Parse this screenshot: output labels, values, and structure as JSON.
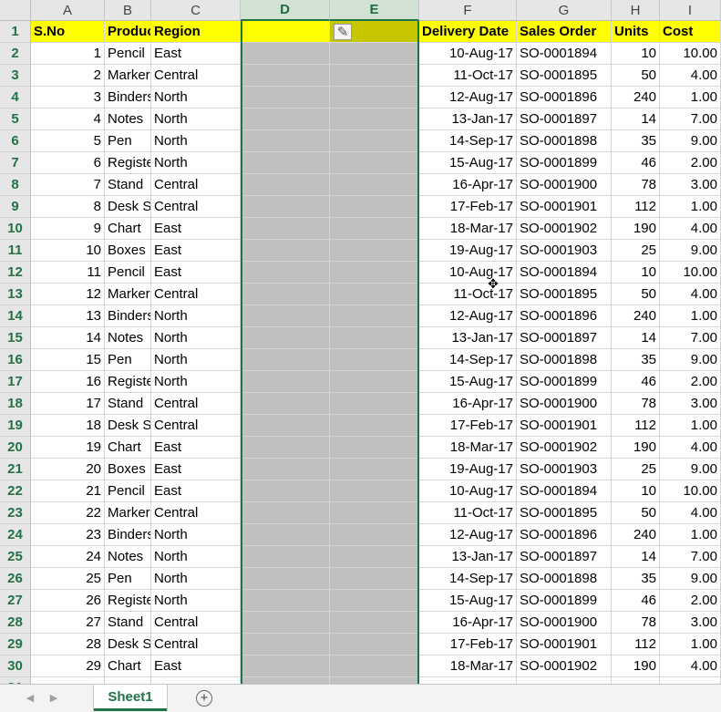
{
  "columns": [
    "A",
    "B",
    "C",
    "D",
    "E",
    "F",
    "G",
    "H",
    "I"
  ],
  "selected_columns": [
    "D",
    "E"
  ],
  "header_row": {
    "A": "S.No",
    "B": "Product",
    "C": "Region",
    "D": "",
    "E": "",
    "F": "Delivery Date",
    "G": "Sales Order",
    "H": "Units",
    "I": "Cost"
  },
  "rows": [
    {
      "sno": "1",
      "product": "Pencil",
      "region": "East",
      "date": "10-Aug-17",
      "order": "SO-0001894",
      "units": "10",
      "cost": "10.00"
    },
    {
      "sno": "2",
      "product": "Markers",
      "region": "Central",
      "date": "11-Oct-17",
      "order": "SO-0001895",
      "units": "50",
      "cost": "4.00"
    },
    {
      "sno": "3",
      "product": "Binders",
      "region": "North",
      "date": "12-Aug-17",
      "order": "SO-0001896",
      "units": "240",
      "cost": "1.00"
    },
    {
      "sno": "4",
      "product": "Notes",
      "region": "North",
      "date": "13-Jan-17",
      "order": "SO-0001897",
      "units": "14",
      "cost": "7.00"
    },
    {
      "sno": "5",
      "product": "Pen",
      "region": "North",
      "date": "14-Sep-17",
      "order": "SO-0001898",
      "units": "35",
      "cost": "9.00"
    },
    {
      "sno": "6",
      "product": "Register",
      "region": "North",
      "date": "15-Aug-17",
      "order": "SO-0001899",
      "units": "46",
      "cost": "2.00"
    },
    {
      "sno": "7",
      "product": "Stand",
      "region": "Central",
      "date": "16-Apr-17",
      "order": "SO-0001900",
      "units": "78",
      "cost": "3.00"
    },
    {
      "sno": "8",
      "product": "Desk Set",
      "region": "Central",
      "date": "17-Feb-17",
      "order": "SO-0001901",
      "units": "112",
      "cost": "1.00"
    },
    {
      "sno": "9",
      "product": "Chart",
      "region": "East",
      "date": "18-Mar-17",
      "order": "SO-0001902",
      "units": "190",
      "cost": "4.00"
    },
    {
      "sno": "10",
      "product": "Boxes",
      "region": "East",
      "date": "19-Aug-17",
      "order": "SO-0001903",
      "units": "25",
      "cost": "9.00"
    },
    {
      "sno": "11",
      "product": "Pencil",
      "region": "East",
      "date": "10-Aug-17",
      "order": "SO-0001894",
      "units": "10",
      "cost": "10.00"
    },
    {
      "sno": "12",
      "product": "Markers",
      "region": "Central",
      "date": "11-Oct-17",
      "order": "SO-0001895",
      "units": "50",
      "cost": "4.00"
    },
    {
      "sno": "13",
      "product": "Binders",
      "region": "North",
      "date": "12-Aug-17",
      "order": "SO-0001896",
      "units": "240",
      "cost": "1.00"
    },
    {
      "sno": "14",
      "product": "Notes",
      "region": "North",
      "date": "13-Jan-17",
      "order": "SO-0001897",
      "units": "14",
      "cost": "7.00"
    },
    {
      "sno": "15",
      "product": "Pen",
      "region": "North",
      "date": "14-Sep-17",
      "order": "SO-0001898",
      "units": "35",
      "cost": "9.00"
    },
    {
      "sno": "16",
      "product": "Register",
      "region": "North",
      "date": "15-Aug-17",
      "order": "SO-0001899",
      "units": "46",
      "cost": "2.00"
    },
    {
      "sno": "17",
      "product": "Stand",
      "region": "Central",
      "date": "16-Apr-17",
      "order": "SO-0001900",
      "units": "78",
      "cost": "3.00"
    },
    {
      "sno": "18",
      "product": "Desk Set",
      "region": "Central",
      "date": "17-Feb-17",
      "order": "SO-0001901",
      "units": "112",
      "cost": "1.00"
    },
    {
      "sno": "19",
      "product": "Chart",
      "region": "East",
      "date": "18-Mar-17",
      "order": "SO-0001902",
      "units": "190",
      "cost": "4.00"
    },
    {
      "sno": "20",
      "product": "Boxes",
      "region": "East",
      "date": "19-Aug-17",
      "order": "SO-0001903",
      "units": "25",
      "cost": "9.00"
    },
    {
      "sno": "21",
      "product": "Pencil",
      "region": "East",
      "date": "10-Aug-17",
      "order": "SO-0001894",
      "units": "10",
      "cost": "10.00"
    },
    {
      "sno": "22",
      "product": "Markers",
      "region": "Central",
      "date": "11-Oct-17",
      "order": "SO-0001895",
      "units": "50",
      "cost": "4.00"
    },
    {
      "sno": "23",
      "product": "Binders",
      "region": "North",
      "date": "12-Aug-17",
      "order": "SO-0001896",
      "units": "240",
      "cost": "1.00"
    },
    {
      "sno": "24",
      "product": "Notes",
      "region": "North",
      "date": "13-Jan-17",
      "order": "SO-0001897",
      "units": "14",
      "cost": "7.00"
    },
    {
      "sno": "25",
      "product": "Pen",
      "region": "North",
      "date": "14-Sep-17",
      "order": "SO-0001898",
      "units": "35",
      "cost": "9.00"
    },
    {
      "sno": "26",
      "product": "Register",
      "region": "North",
      "date": "15-Aug-17",
      "order": "SO-0001899",
      "units": "46",
      "cost": "2.00"
    },
    {
      "sno": "27",
      "product": "Stand",
      "region": "Central",
      "date": "16-Apr-17",
      "order": "SO-0001900",
      "units": "78",
      "cost": "3.00"
    },
    {
      "sno": "28",
      "product": "Desk Set",
      "region": "Central",
      "date": "17-Feb-17",
      "order": "SO-0001901",
      "units": "112",
      "cost": "1.00"
    },
    {
      "sno": "29",
      "product": "Chart",
      "region": "East",
      "date": "18-Mar-17",
      "order": "SO-0001902",
      "units": "190",
      "cost": "4.00"
    }
  ],
  "paint_icon": "format-painter-icon",
  "cursor_icon": "move-cursor-icon",
  "tabs": {
    "sheet1": "Sheet1",
    "add_sheet": "+",
    "prev": "◀",
    "next": "▶"
  },
  "colors": {
    "header_fill": "#ffff00",
    "selection_border": "#217346",
    "blank_column_fill": "#c0c0c0"
  }
}
